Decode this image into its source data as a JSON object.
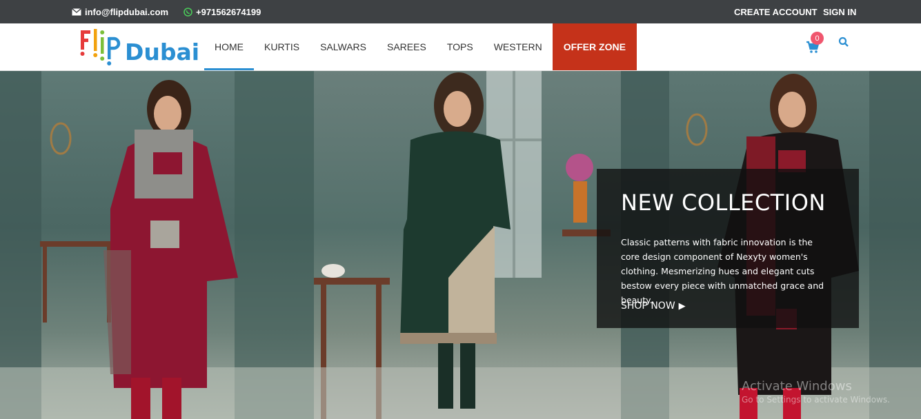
{
  "topbar": {
    "email": "info@flipdubai.com",
    "phone": "+971562674199",
    "create_account": "CREATE ACCOUNT",
    "sign_in": "SIGN IN",
    "email_icon": "envelope-icon",
    "phone_icon": "whatsapp-icon"
  },
  "logo": {
    "part1": "Flip",
    "part2": "Dubai",
    "colors": [
      "#e63b3b",
      "#f2a20f",
      "#7bbf3a",
      "#2b8fd2"
    ]
  },
  "nav": {
    "items": [
      {
        "label": "HOME",
        "active": true
      },
      {
        "label": "KURTIS"
      },
      {
        "label": "SALWARS"
      },
      {
        "label": "SAREES"
      },
      {
        "label": "TOPS"
      },
      {
        "label": "WESTERN"
      },
      {
        "label": "OFFER ZONE",
        "highlight": true
      }
    ],
    "offer_color": "#c5321a",
    "active_color": "#2b8fd2"
  },
  "cart": {
    "count": "0",
    "icon": "cart-icon"
  },
  "search": {
    "icon": "search-icon"
  },
  "hero": {
    "title": "NEW COLLECTION",
    "description": "Classic patterns with fabric innovation is the core design component of Nexyty women's clothing. Mesmerizing hues and elegant cuts bestow every piece with unmatched grace and beauty.",
    "cta": "SHOP NOW"
  },
  "watermark": {
    "line1": "Activate Windows",
    "line2": "Go to Settings to activate Windows."
  }
}
